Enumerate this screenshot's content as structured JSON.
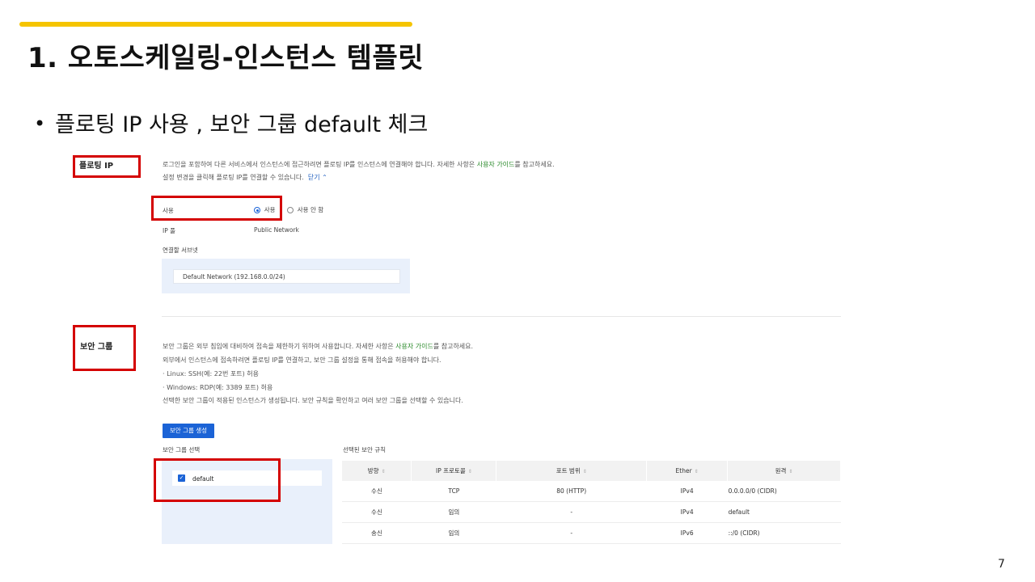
{
  "slide": {
    "title": "1. 오토스케일링-인스턴스 템플릿",
    "bullet": "플로팅 IP 사용 , 보안 그룹 default 체크",
    "page_number": "7"
  },
  "floating_ip": {
    "section_label": "플로팅 IP",
    "desc_prefix": "로그인을 포함하여 다른 서비스에서 인스턴스에 접근하려면 플로팅 IP를 인스턴스에 연결해야 합니다. 자세한 사항은 ",
    "desc_link": "사용자 가이드",
    "desc_suffix": "를 참고하세요.",
    "desc2": "설정 변경을 클릭해 플로팅 IP를 연결할 수 있습니다.",
    "close_link": "닫기",
    "use_label": "사용",
    "option_use": "사용",
    "option_no_use": "사용 안 함",
    "ip_pool_label": "IP 풀",
    "ip_pool_value": "Public Network",
    "subnet_label": "연결할 서브넷",
    "subnet_value": "Default Network (192.168.0.0/24)"
  },
  "security_group": {
    "section_label": "보안 그룹",
    "desc1_prefix": "보안 그룹은 외부 침입에 대비하여 접속을 제한하기 위하여 사용합니다. 자세한 사항은 ",
    "desc1_link": "사용자 가이드",
    "desc1_suffix": "를 참고하세요.",
    "desc2": "외부에서 인스턴스에 접속하려면 플로팅 IP를 연결하고, 보안 그룹 설정을 통해 접속을 허용해야 합니다.",
    "desc3": "· Linux: SSH(예: 22번 포트) 허용",
    "desc4": "· Windows: RDP(예: 3389 포트) 허용",
    "desc5": "선택한 보안 그룹이 적용된 인스턴스가 생성됩니다. 보안 규칙을 확인하고 여러 보안 그룹을 선택할 수 있습니다.",
    "create_button": "보안 그룹 생성",
    "select_label": "보안 그룹 선택",
    "selected_item": "default",
    "rules_label": "선택된 보안 규칙",
    "columns": [
      "방향",
      "IP 프로토콜",
      "포트 범위",
      "Ether",
      "원격"
    ],
    "rows": [
      [
        "수신",
        "TCP",
        "80 (HTTP)",
        "IPv4",
        "0.0.0.0/0 (CIDR)"
      ],
      [
        "수신",
        "임의",
        "-",
        "IPv4",
        "default"
      ],
      [
        "송신",
        "임의",
        "-",
        "IPv6",
        "::/0 (CIDR)"
      ]
    ]
  },
  "colors": {
    "accent_bar": "#f5c400",
    "highlight_box": "#d40000",
    "primary_button": "#1b63d6",
    "panel_bg": "#e9f0fb",
    "link_green": "#2a8a2a"
  }
}
